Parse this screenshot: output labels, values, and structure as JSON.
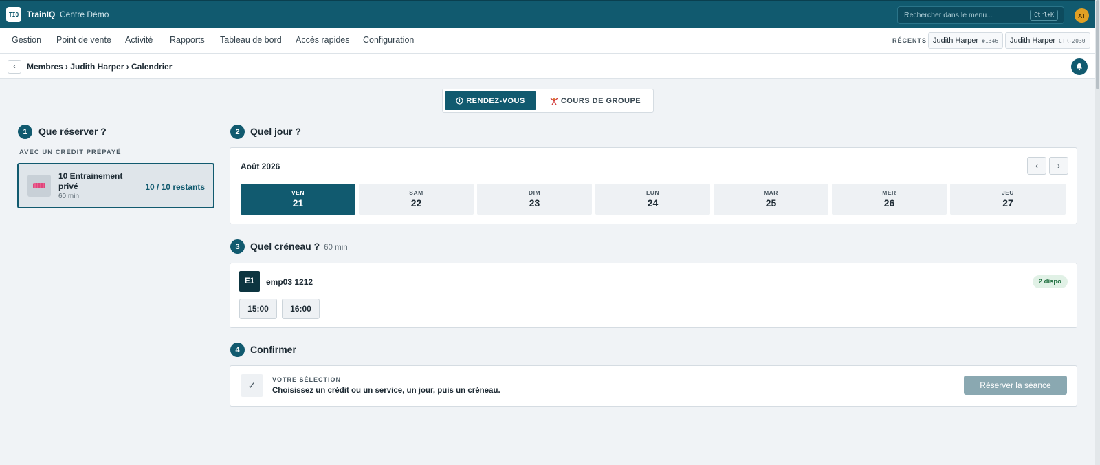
{
  "app": {
    "logo": "TIQ",
    "name": "TrainIQ",
    "centre": "Centre Démo",
    "user_initials": "AT"
  },
  "search": {
    "placeholder": "Rechercher dans le menu...",
    "shortcut": "Ctrl+K"
  },
  "nav": {
    "items": [
      "Gestion",
      "Point de vente",
      "Activité",
      "Rapports",
      "Tableau de bord",
      "Accès rapides",
      "Configuration"
    ]
  },
  "recents": {
    "label": "RÉCENTS",
    "items": [
      {
        "name": "Judith Harper",
        "code": "#1346"
      },
      {
        "name": "Judith Harper",
        "code": "CTR-2030"
      }
    ]
  },
  "breadcrumb": {
    "back": "‹",
    "path": "Membres › Judith Harper › Calendrier"
  },
  "toggle": {
    "active": "RENDEZ-VOUS",
    "inactive": "COURS DE GROUPE"
  },
  "step1": {
    "num": "1",
    "title": "Que réserver ?",
    "section_label": "AVEC UN CRÉDIT PRÉPAYÉ",
    "credit": {
      "name": "10 Entrainement privé",
      "duration": "60 min",
      "remaining": "10 / 10 restants"
    }
  },
  "step2": {
    "num": "2",
    "title": "Quel jour ?",
    "month": "Août 2026",
    "prev": "‹",
    "next": "›",
    "days": [
      {
        "dow": "VEN",
        "num": "21",
        "selected": true
      },
      {
        "dow": "SAM",
        "num": "22"
      },
      {
        "dow": "DIM",
        "num": "23"
      },
      {
        "dow": "LUN",
        "num": "24"
      },
      {
        "dow": "MAR",
        "num": "25"
      },
      {
        "dow": "MER",
        "num": "26"
      },
      {
        "dow": "JEU",
        "num": "27"
      }
    ]
  },
  "step3": {
    "num": "3",
    "title": "Quel créneau ?",
    "duration": "60 min",
    "employee": {
      "badge": "E1",
      "name": "emp03 1212",
      "availability": "2 dispo"
    },
    "slots": [
      "15:00",
      "16:00"
    ]
  },
  "step4": {
    "num": "4",
    "title": "Confirmer",
    "check": "✓",
    "selection_label": "VOTRE SÉLECTION",
    "selection_text": "Choisissez un crédit ou un service, un jour, puis un créneau.",
    "button": "Réserver la séance"
  },
  "colors": {
    "primary": "#115a6f",
    "avatar": "#e0a024",
    "disabled_button": "#8aa8b1"
  }
}
